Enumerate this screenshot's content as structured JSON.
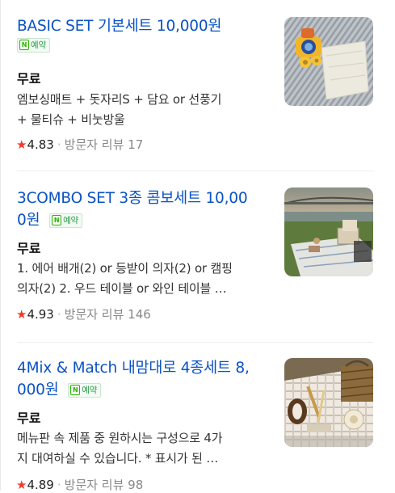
{
  "items": [
    {
      "title_line1": "BASIC SET 기본세트 10,000원",
      "title_line2": "",
      "badge": "예약",
      "price": "무료",
      "desc_line1": "엠보싱매트 + 돗자리S + 담요 or 선풍기",
      "desc_line2": "+ 물티슈 + 비눗방울",
      "rating": "4.83",
      "reviews": "방문자 리뷰 17"
    },
    {
      "title_line1": "3COMBO SET 3종 콤보세트 10,00",
      "title_line2": "0원",
      "badge": "예약",
      "price": "무료",
      "desc_line1": "1. 에어 배개(2) or 등받이 의자(2) or 캠핑",
      "desc_line2": "의자(2) 2. 우드 테이블 or 와인 테이블 …",
      "rating": "4.93",
      "reviews": "방문자 리뷰 146"
    },
    {
      "title_line1": "4Mix & Match 내맘대로 4종세트 8,",
      "title_line2": "000원",
      "badge": "예약",
      "price": "무료",
      "desc_line1": "메뉴판 속 제품 중 원하시는 구성으로 4가",
      "desc_line2": "지 대여하실 수 있습니다. * 표시가 된 …",
      "rating": "4.89",
      "reviews": "방문자 리뷰 98"
    }
  ],
  "badge_logo": "N",
  "star_glyph": "★",
  "separator": "·",
  "colors": {
    "title": "#0a52c4",
    "star": "#f23a2d",
    "badge_green": "#2db400"
  }
}
